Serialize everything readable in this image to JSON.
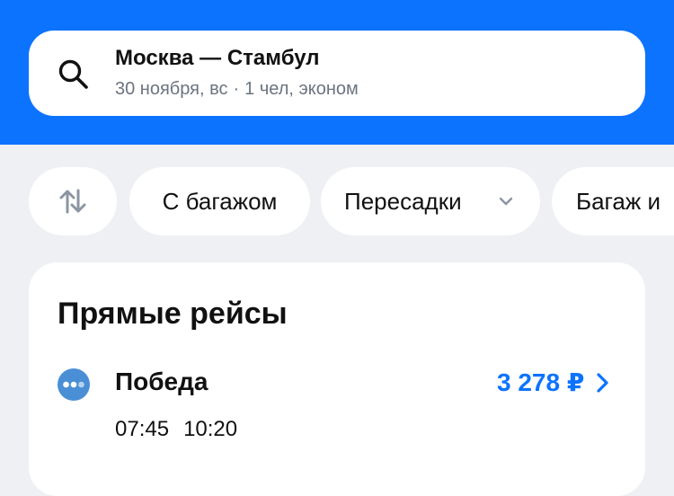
{
  "search": {
    "route": "Москва — Стамбул",
    "date": "30 ноября, вс",
    "separator": "·",
    "passengers": "1 чел, эконом"
  },
  "filters": {
    "sort_icon": "sort-arrows-icon",
    "chips": [
      "С багажом",
      "Пересадки",
      "Багаж и"
    ]
  },
  "results": {
    "section_title": "Прямые рейсы",
    "flights": [
      {
        "airline": "Победа",
        "logo_icon": "pobeda-logo-icon",
        "price": "3 278 ₽",
        "depart": "07:45",
        "arrive": "10:20"
      }
    ]
  },
  "colors": {
    "accent": "#0c73fe",
    "background": "#eef0f4",
    "card": "#ffffff",
    "muted_text": "#6b7480",
    "logo": "#4a8fd6"
  }
}
